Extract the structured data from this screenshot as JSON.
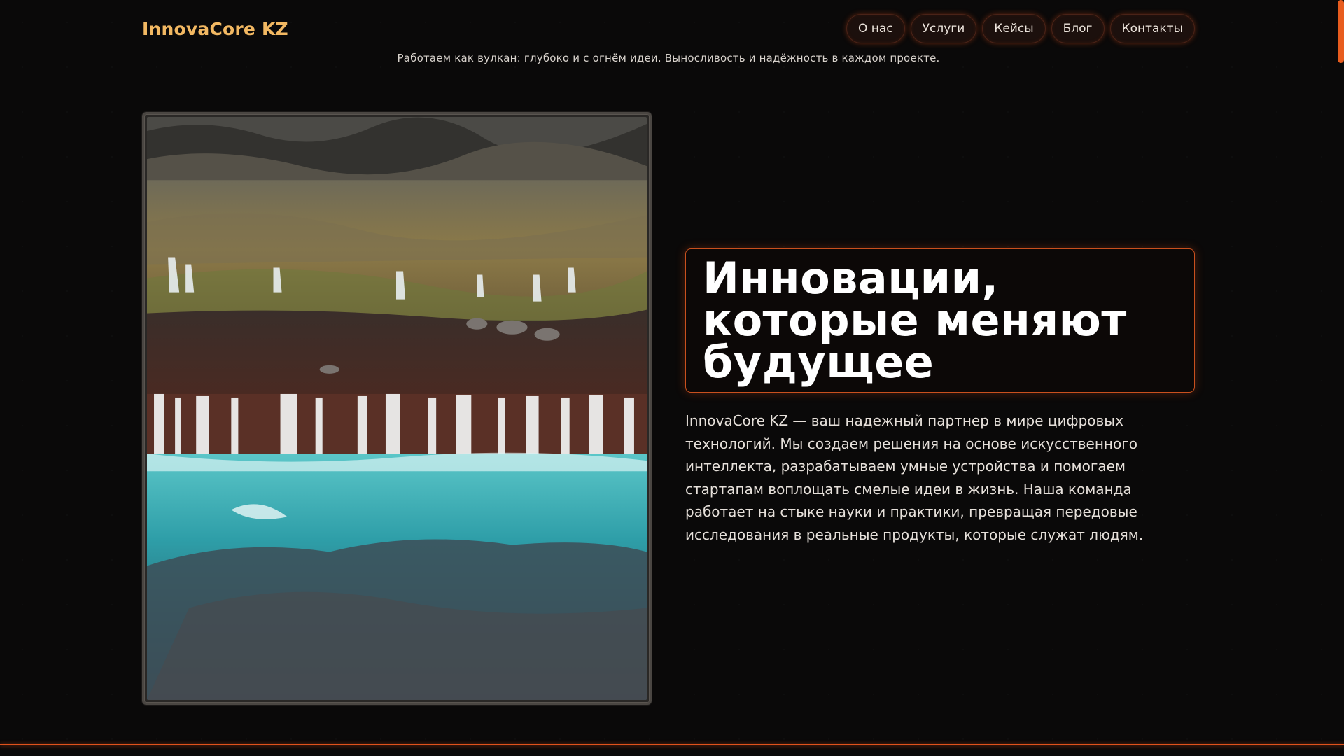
{
  "header": {
    "logo": "InnovaCore KZ",
    "nav": [
      {
        "label": "О нас"
      },
      {
        "label": "Услуги"
      },
      {
        "label": "Кейсы"
      },
      {
        "label": "Блог"
      },
      {
        "label": "Контакты"
      }
    ]
  },
  "tagline": "Работаем как вулкан: глубоко и с огнём идеи. Выносливость и надёжность в каждом проекте.",
  "hero": {
    "headline": "Инновации, которые меняют будущее",
    "description": "InnovaCore KZ — ваш надежный партнер в мире цифровых технологий. Мы создаем решения на основе искусственного интеллекта, разрабатываем умные устройства и помогаем стартапам воплощать смелые идеи в жизнь. Наша команда работает на стыке науки и практики, превращая передовые исследования в реальные продукты, которые служат людям."
  },
  "colors": {
    "accent": "#e0521c",
    "logo": "#f2b862",
    "background": "#0a0909"
  }
}
